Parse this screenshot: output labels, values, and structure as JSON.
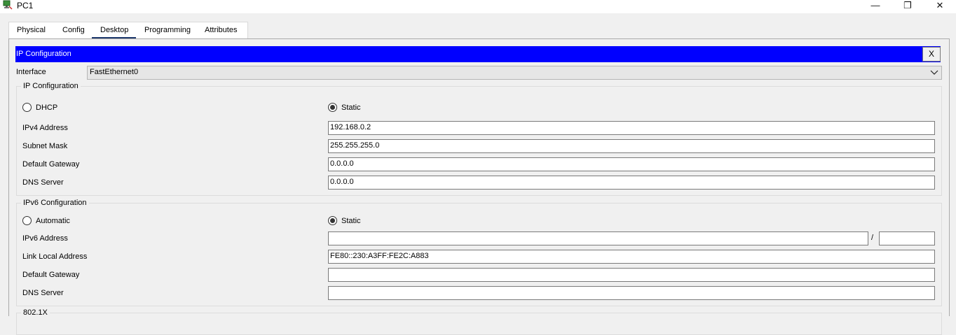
{
  "window": {
    "title": "PC1",
    "minimize_glyph": "—",
    "maximize_glyph": "❐",
    "close_glyph": "✕",
    "app_icon": "pc-icon"
  },
  "tabs": [
    {
      "label": "Physical",
      "active": false
    },
    {
      "label": "Config",
      "active": false
    },
    {
      "label": "Desktop",
      "active": true
    },
    {
      "label": "Programming",
      "active": false
    },
    {
      "label": "Attributes",
      "active": false
    }
  ],
  "ip_config": {
    "header_title": "IP Configuration",
    "close_label": "X",
    "header_color": "#0000ff",
    "interface_label": "Interface",
    "interface_value": "FastEthernet0",
    "ipv4": {
      "legend": "IP Configuration",
      "dhcp_label": "DHCP",
      "static_label": "Static",
      "mode": "Static",
      "ipv4_address_label": "IPv4 Address",
      "ipv4_address": "192.168.0.2",
      "subnet_mask_label": "Subnet Mask",
      "subnet_mask": "255.255.255.0",
      "default_gateway_label": "Default Gateway",
      "default_gateway": "0.0.0.0",
      "dns_server_label": "DNS Server",
      "dns_server": "0.0.0.0"
    },
    "ipv6": {
      "legend": "IPv6 Configuration",
      "automatic_label": "Automatic",
      "static_label": "Static",
      "mode": "Static",
      "ipv6_address_label": "IPv6 Address",
      "ipv6_address": "",
      "prefix_separator": "/",
      "prefix_length": "",
      "link_local_label": "Link Local Address",
      "link_local_address": "FE80::230:A3FF:FE2C:A883",
      "default_gateway_label": "Default Gateway",
      "default_gateway": "",
      "dns_server_label": "DNS Server",
      "dns_server": ""
    },
    "dot1x": {
      "legend": "802.1X"
    }
  }
}
